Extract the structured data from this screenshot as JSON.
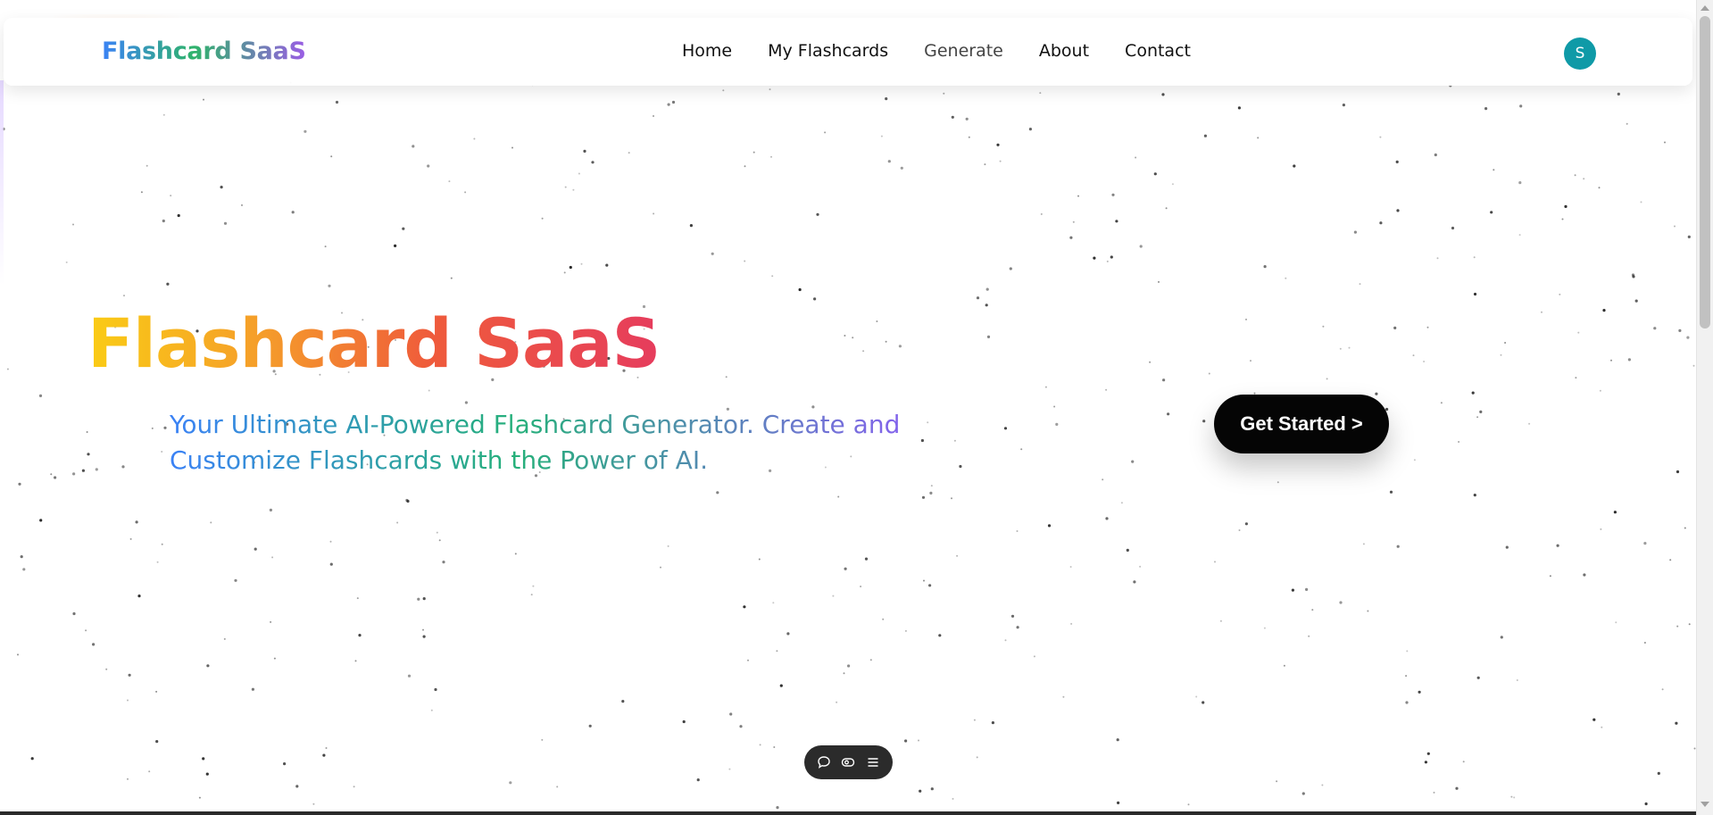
{
  "navbar": {
    "brand": "Flashcard SaaS",
    "links": [
      {
        "label": "Home"
      },
      {
        "label": "My Flashcards"
      },
      {
        "label": "Generate"
      },
      {
        "label": "About"
      },
      {
        "label": "Contact"
      }
    ],
    "avatar_initial": "S"
  },
  "hero": {
    "title": "Flashcard SaaS",
    "subtitle": "Your Ultimate AI-Powered Flashcard Generator. Create and Customize Flashcards with the Power of AI.",
    "cta_label": "Get Started >"
  },
  "dock": {
    "icons": [
      "chat-icon",
      "eye-icon",
      "menu-icon"
    ]
  },
  "colors": {
    "brand_gradient": [
      "#3b82f6",
      "#2fb36b",
      "#9b5de5"
    ],
    "hero_gradient": [
      "#facc15",
      "#f59e2a",
      "#ef5b3b",
      "#e63c5d"
    ],
    "avatar": "#0f9aa7",
    "cta": "#050505"
  }
}
